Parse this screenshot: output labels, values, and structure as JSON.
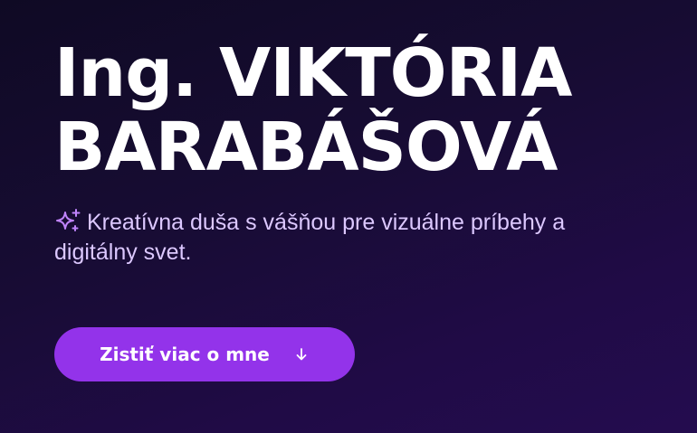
{
  "hero": {
    "name_line1": "Ing. VIKTÓRIA",
    "name_line2": "BARABÁŠOVÁ",
    "tagline_icon": "sparkles-icon",
    "tagline": "Kreatívna duša s vášňou pre vizuálne príbehy a digitálny svet.",
    "cta_label": "Zistiť viac o mne",
    "cta_icon": "arrow-down-icon"
  },
  "colors": {
    "background": "#170c33",
    "accent": "#9333ea",
    "tagline_text": "#dcc8ff",
    "sparkle": "#c084fc"
  }
}
